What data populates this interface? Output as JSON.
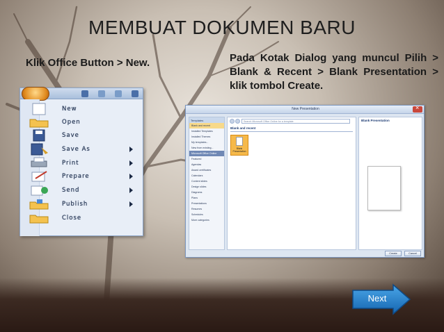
{
  "slide": {
    "title": "MEMBUAT DOKUMEN BARU",
    "left_caption": "Klik Office Button > New.",
    "right_caption": "Pada Kotak Dialog yang muncul Pilih > Blank & Recent > Blank Presentation > klik tombol Create."
  },
  "office_menu": {
    "items": [
      {
        "label": "New",
        "icon": "new-document-icon",
        "has_submenu": false
      },
      {
        "label": "Open",
        "icon": "open-folder-icon",
        "has_submenu": false
      },
      {
        "label": "Save",
        "icon": "save-disk-icon",
        "has_submenu": false
      },
      {
        "label": "Save As",
        "icon": "save-as-icon",
        "has_submenu": true
      },
      {
        "label": "Print",
        "icon": "printer-icon",
        "has_submenu": true
      },
      {
        "label": "Prepare",
        "icon": "prepare-icon",
        "has_submenu": true
      },
      {
        "label": "Send",
        "icon": "send-icon",
        "has_submenu": true
      },
      {
        "label": "Publish",
        "icon": "publish-icon",
        "has_submenu": true
      },
      {
        "label": "Close",
        "icon": "close-folder-icon",
        "has_submenu": false
      }
    ]
  },
  "dialog": {
    "title": "New Presentation",
    "left_header": "Templates",
    "left_items": [
      "Blank and recent",
      "Installed Templates",
      "Installed Themes",
      "My templates...",
      "New from existing...",
      "Microsoft Office Online",
      "Featured",
      "Agendas",
      "Award certificates",
      "Calendars",
      "Content slides",
      "Design slides",
      "Diagrams",
      "Plans",
      "Presentations",
      "Resumes",
      "Schedules",
      "More categories"
    ],
    "search_placeholder": "Search Microsoft Office Online for a template",
    "section_title": "Blank and recent",
    "blank_label": "Blank Presentation",
    "right_header": "Blank Presentation",
    "create_label": "Create",
    "cancel_label": "Cancel"
  },
  "navigation": {
    "next_label": "Next"
  }
}
